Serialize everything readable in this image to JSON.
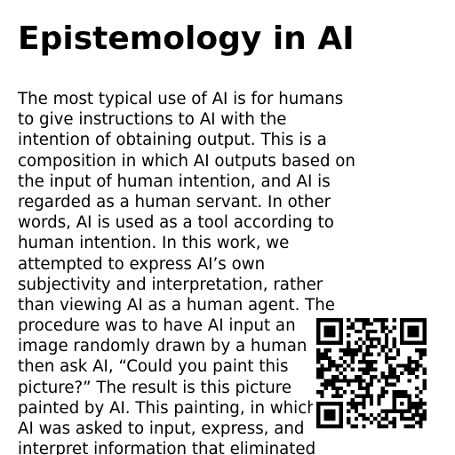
{
  "document": {
    "title": "Epistemology in AI",
    "body_lines": [
      "The most typical use of AI is for humans",
      "to give instructions to AI with the",
      "intention of obtaining output. This is a",
      "composition in which AI outputs based on",
      "the input of human intention, and AI is",
      "regarded as a human servant. In other",
      "words, AI is used as a tool according to",
      "human intention. In this work, we",
      "attempted to express AI’s own",
      "subjectivity and interpretation, rather",
      "than viewing AI as a human agent. The",
      "procedure was to have AI input an",
      "image randomly drawn by a human and",
      "then ask AI, “Could you paint this",
      "picture?” The result is this picture",
      "painted by AI. This painting, in which",
      "AI was asked to input, express, and",
      "interpret information that eliminated"
    ]
  },
  "qr_code": {
    "icon": "qr-code-icon",
    "color": "#000000",
    "background": "#ffffff"
  }
}
